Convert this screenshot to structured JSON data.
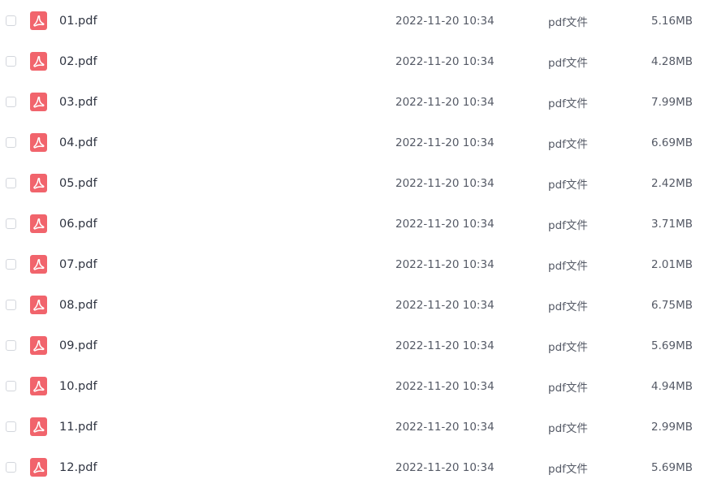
{
  "colors": {
    "pdf_icon": "#f1646c",
    "checkbox_border": "#d3d6dc",
    "text_primary": "#2f3441",
    "text_secondary": "#555a66"
  },
  "icon": "pdf-file-icon",
  "files": [
    {
      "name": "01.pdf",
      "date": "2022-11-20 10:34",
      "type": "pdf文件",
      "size": "5.16MB"
    },
    {
      "name": "02.pdf",
      "date": "2022-11-20 10:34",
      "type": "pdf文件",
      "size": "4.28MB"
    },
    {
      "name": "03.pdf",
      "date": "2022-11-20 10:34",
      "type": "pdf文件",
      "size": "7.99MB"
    },
    {
      "name": "04.pdf",
      "date": "2022-11-20 10:34",
      "type": "pdf文件",
      "size": "6.69MB"
    },
    {
      "name": "05.pdf",
      "date": "2022-11-20 10:34",
      "type": "pdf文件",
      "size": "2.42MB"
    },
    {
      "name": "06.pdf",
      "date": "2022-11-20 10:34",
      "type": "pdf文件",
      "size": "3.71MB"
    },
    {
      "name": "07.pdf",
      "date": "2022-11-20 10:34",
      "type": "pdf文件",
      "size": "2.01MB"
    },
    {
      "name": "08.pdf",
      "date": "2022-11-20 10:34",
      "type": "pdf文件",
      "size": "6.75MB"
    },
    {
      "name": "09.pdf",
      "date": "2022-11-20 10:34",
      "type": "pdf文件",
      "size": "5.69MB"
    },
    {
      "name": "10.pdf",
      "date": "2022-11-20 10:34",
      "type": "pdf文件",
      "size": "4.94MB"
    },
    {
      "name": "11.pdf",
      "date": "2022-11-20 10:34",
      "type": "pdf文件",
      "size": "2.99MB"
    },
    {
      "name": "12.pdf",
      "date": "2022-11-20 10:34",
      "type": "pdf文件",
      "size": "5.69MB"
    }
  ]
}
